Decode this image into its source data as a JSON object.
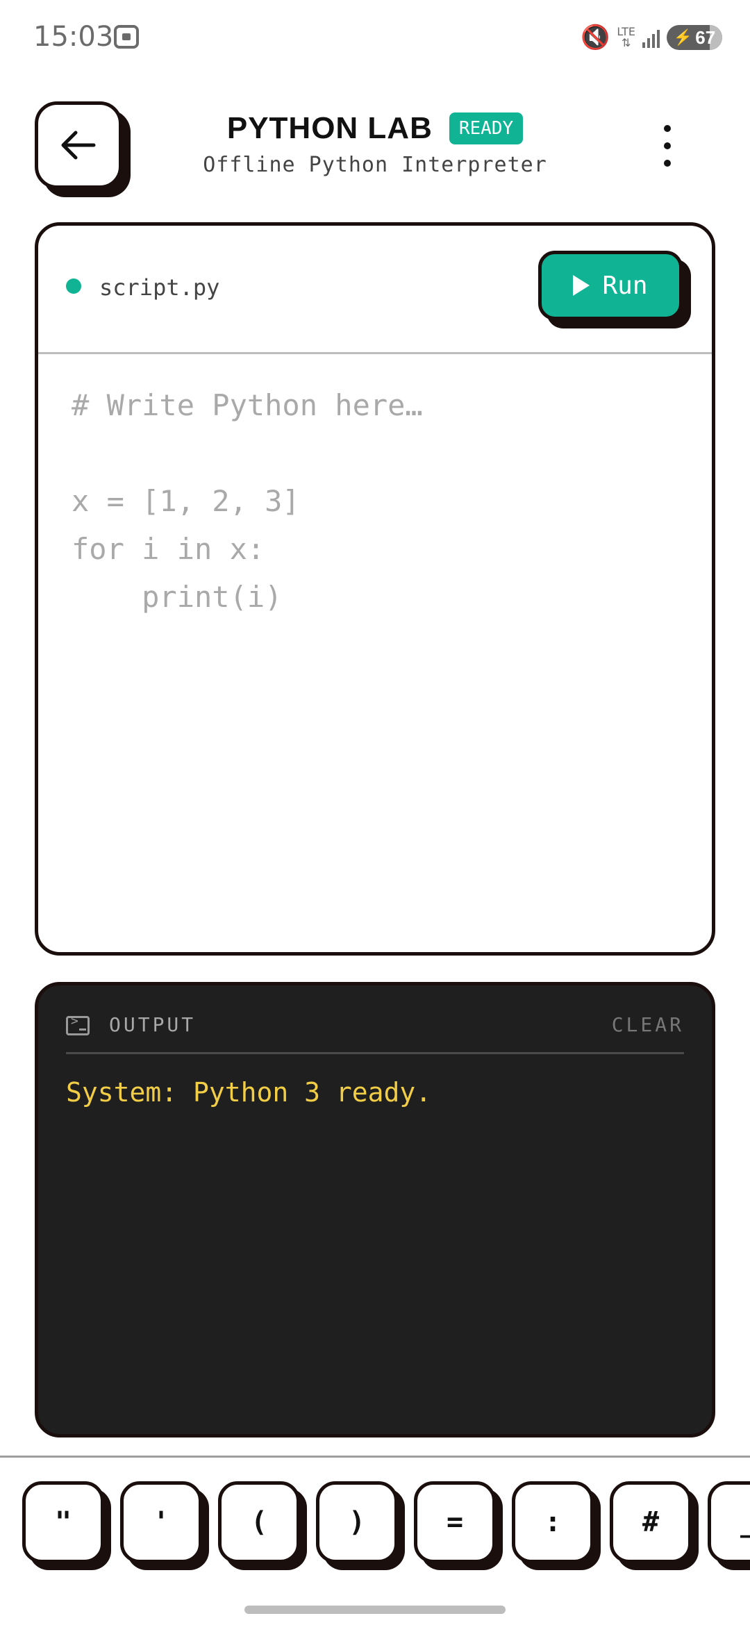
{
  "status": {
    "time": "15:03",
    "network": "LTE",
    "battery": "67"
  },
  "header": {
    "title": "PYTHON LAB",
    "badge": "READY",
    "subtitle": "Offline Python Interpreter"
  },
  "editor": {
    "filename": "script.py",
    "run_label": "Run",
    "placeholder_lines": [
      "# Write Python here…",
      "",
      "x = [1, 2, 3]",
      "for i in x:",
      "    print(i)"
    ]
  },
  "output": {
    "title": "OUTPUT",
    "clear_label": "CLEAR",
    "lines": [
      "System: Python 3 ready."
    ]
  },
  "symbols": [
    "\"",
    "'",
    "(",
    ")",
    "=",
    ":",
    "#",
    "_"
  ],
  "colors": {
    "accent": "#10b495",
    "border": "#1a0f0c",
    "output_bg": "#1f1f1f",
    "output_text": "#f2cd46"
  }
}
